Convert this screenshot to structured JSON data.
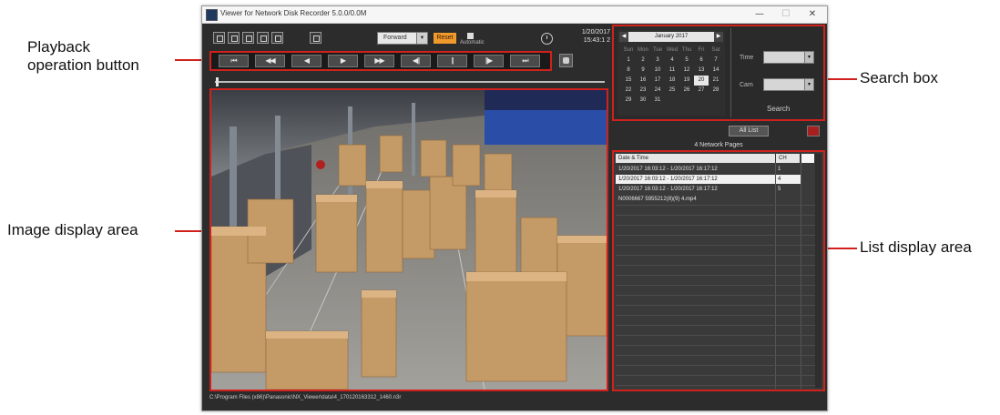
{
  "callouts": {
    "playback_line1": "Playback",
    "playback_line2": "operation button",
    "image_display": "Image display area",
    "search_box": "Search box",
    "list_display": "List display area"
  },
  "window": {
    "title": "Viewer for Network Disk Recorder 5.0.0/0.0M",
    "controls": [
      "—",
      "☐",
      "✕"
    ]
  },
  "toolbar": {
    "mode_select": "Forward",
    "orange_button": "Reset",
    "small_label": "Automatic",
    "date": "1/20/2017",
    "time": "15:43:1 2"
  },
  "playback": {
    "buttons": [
      "⏮",
      "◀◀",
      "◀",
      "▶",
      "▶▶",
      "◀||",
      "||",
      "||▶",
      "⏭"
    ]
  },
  "statusbar": {
    "filepath": "C:\\Program Files (x86)\\Panasonic\\NX_Viewer\\data\\4_170120163312_1460.n3r"
  },
  "search": {
    "calendar_title": "January 2017",
    "weekdays": [
      "Sun",
      "Mon",
      "Tue",
      "Wed",
      "Thu",
      "Fri",
      "Sat"
    ],
    "weeks": [
      [
        "1",
        "2",
        "3",
        "4",
        "5",
        "6",
        "7"
      ],
      [
        "8",
        "9",
        "10",
        "11",
        "12",
        "13",
        "14"
      ],
      [
        "15",
        "16",
        "17",
        "18",
        "19",
        "20",
        "21"
      ],
      [
        "22",
        "23",
        "24",
        "25",
        "26",
        "27",
        "28"
      ],
      [
        "29",
        "30",
        "31",
        "",
        "",
        "",
        ""
      ]
    ],
    "selected_day": "20",
    "time_label": "Time",
    "camera_label": "Cam",
    "search_button": "Search"
  },
  "list": {
    "all_list_button": "All List",
    "pages": "4 Network Pages",
    "header_date": "Date & Time",
    "header_ch": "CH",
    "rows": [
      {
        "date": "1/20/2017 16:03:12 - 1/20/2017 16:17:12",
        "ch": "1"
      },
      {
        "date": "1/20/2017 16:03:12 - 1/20/2017 16:17:12",
        "ch": "4"
      },
      {
        "date": "1/20/2017 16:03:12 - 1/20/2017 16:17:12",
        "ch": "5"
      },
      {
        "date": "N0006667 5955212(8)(9) 4.mp4",
        "ch": ""
      }
    ]
  },
  "colors": {
    "highlight": "#d0211c",
    "accent_orange": "#f09a2c"
  }
}
